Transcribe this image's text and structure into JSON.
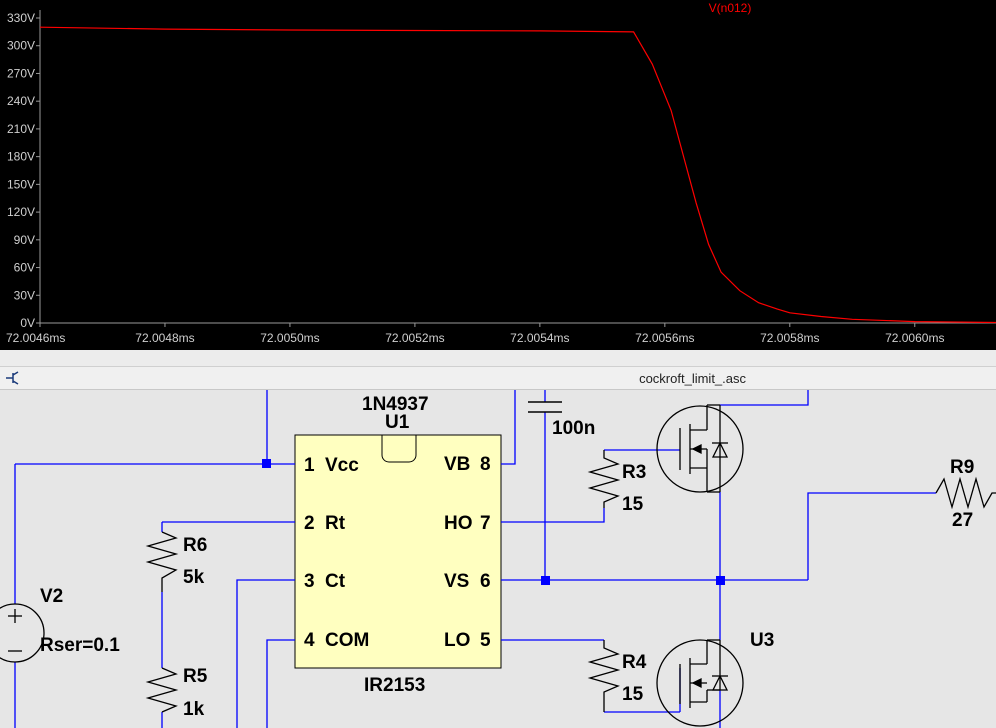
{
  "waveform": {
    "trace_name": "V(n012)",
    "trace_color": "#ff0000",
    "background": "#000000",
    "y_ticks": [
      "330V",
      "300V",
      "270V",
      "240V",
      "210V",
      "180V",
      "150V",
      "120V",
      "90V",
      "60V",
      "30V",
      "0V"
    ],
    "x_ticks": [
      "72.0046ms",
      "72.0048ms",
      "72.0050ms",
      "72.0052ms",
      "72.0054ms",
      "72.0056ms",
      "72.0058ms",
      "72.0060ms"
    ]
  },
  "chart_data": {
    "type": "line",
    "title": "",
    "xlabel": "",
    "ylabel": "",
    "x_unit": "ms",
    "y_unit": "V",
    "xlim": [
      72.0046,
      72.00613
    ],
    "ylim": [
      0,
      330
    ],
    "grid": false,
    "legend": "top-center",
    "series": [
      {
        "name": "V(n012)",
        "color": "#ff0000",
        "x": [
          72.0046,
          72.0048,
          72.005,
          72.0052,
          72.0054,
          72.00555,
          72.00558,
          72.00561,
          72.00563,
          72.00565,
          72.00567,
          72.00569,
          72.00572,
          72.00575,
          72.00578,
          72.0058,
          72.00585,
          72.0059,
          72.006,
          72.00613
        ],
        "y": [
          320,
          318,
          317,
          316.5,
          316,
          315,
          280,
          230,
          180,
          130,
          85,
          55,
          35,
          22,
          15,
          11,
          7,
          4,
          1.5,
          0.5
        ]
      }
    ]
  },
  "schematic": {
    "title": "cockroft_limit_.asc",
    "wire_color": "#0000ff",
    "component_fill": "#ffffc0",
    "labels": {
      "diode": "1N4937",
      "u1": "U1",
      "cap": "100n",
      "r3": "R3",
      "r3_val": "15",
      "r9": "R9",
      "r9_val": "27",
      "r6": "R6",
      "r6_val": "5k",
      "r5": "R5",
      "r5_val": "1k",
      "v2": "V2",
      "v2_rser": "Rser=0.1",
      "r4": "R4",
      "r4_val": "15",
      "u3": "U3",
      "ic_name": "IR2153"
    },
    "ic_pins": {
      "p1": "1",
      "p1n": "Vcc",
      "p2": "2",
      "p2n": "Rt",
      "p3": "3",
      "p3n": "Ct",
      "p4": "4",
      "p4n": "COM",
      "p8": "8",
      "p8n": "VB",
      "p7": "7",
      "p7n": "HO",
      "p6": "6",
      "p6n": "VS",
      "p5": "5",
      "p5n": "LO"
    }
  }
}
